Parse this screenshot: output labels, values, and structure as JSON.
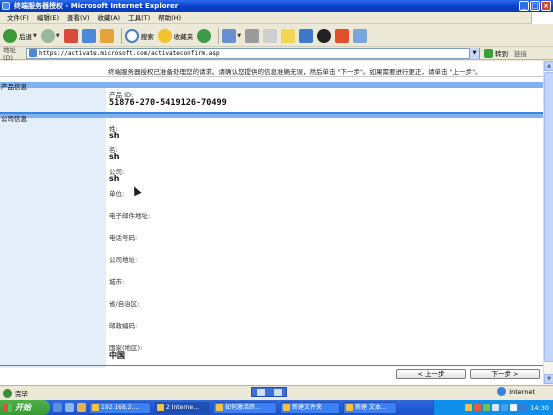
{
  "window": {
    "title": "终端服务器授权 - Microsoft Internet Explorer",
    "caption_buttons": [
      "_",
      "□",
      "×"
    ]
  },
  "menu": [
    "文件(F)",
    "编辑(E)",
    "查看(V)",
    "收藏(A)",
    "工具(T)",
    "帮助(H)"
  ],
  "toolbar": {
    "back_label": "后退",
    "search_label": "搜索",
    "favorites_label": "收藏夹"
  },
  "address": {
    "label": "地址(D)",
    "url": "https://activate.microsoft.com/activateconfirm.asp",
    "go_label": "转到",
    "links_label": "链接"
  },
  "page": {
    "intro": "终端服务器授权已准备处理您的请求。请确认您提供的信息准确无误，然后单击 \"下一步\"。如果需要进行更正，请单击 \"上一步\"。",
    "product_section": "产品信息",
    "product_id_label": "产品 ID:",
    "product_id": "51876-270-5419126-70499",
    "company_section": "公司信息",
    "fields": [
      {
        "label": "姓:",
        "value": "sh"
      },
      {
        "label": "名:",
        "value": "sh"
      },
      {
        "label": "公司:",
        "value": "sh"
      },
      {
        "label": "单位:",
        "value": ""
      },
      {
        "label": "电子邮件地址:",
        "value": ""
      },
      {
        "label": "电话号码:",
        "value": ""
      },
      {
        "label": "公司地址:",
        "value": ""
      },
      {
        "label": "城市:",
        "value": ""
      },
      {
        "label": "省/自治区:",
        "value": ""
      },
      {
        "label": "邮政编码:",
        "value": ""
      },
      {
        "label": "国家(地区):",
        "value": "中国"
      }
    ],
    "back_button": "< 上一步",
    "next_button": "下一步 >"
  },
  "status": {
    "text": "完毕",
    "zone": "Internet"
  },
  "taskbar": {
    "start": "开始",
    "tasks": [
      "192.168.2....",
      "2 Interne...",
      "如何激活终...",
      "新建文件夹",
      "新建 文本..."
    ],
    "clock": "14:30"
  },
  "colors": {
    "titlebar": "#0a3fc8",
    "section_bar": "#7fb2ee",
    "taskbar": "#245edb",
    "start_button": "#3a9a35"
  }
}
